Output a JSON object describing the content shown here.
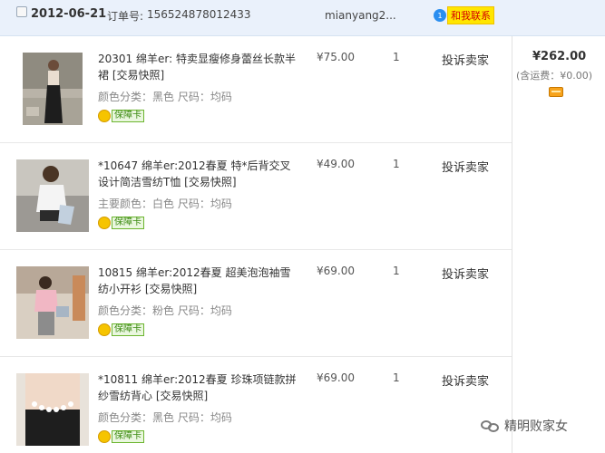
{
  "order": {
    "date": "2012-06-21",
    "order_no_label": "订单号:",
    "order_no": "156524878012433",
    "seller": "mianyang2...",
    "contact_count": "1",
    "contact_label": "和我联系"
  },
  "items": [
    {
      "title": "20301 绵羊er: 特卖显瘦修身蕾丝长款半裙 [交易快照]",
      "attr": "颜色分类：黑色  尺码：均码",
      "guarantee": "保障卡",
      "price": "¥75.00",
      "qty": "1",
      "complain": "投诉卖家"
    },
    {
      "title": "*10647 绵羊er:2012春夏 特*后背交叉设计简洁雪纺T恤 [交易快照]",
      "attr": "主要颜色：白色  尺码：均码",
      "guarantee": "保障卡",
      "price": "¥49.00",
      "qty": "1",
      "complain": "投诉卖家"
    },
    {
      "title": "10815 绵羊er:2012春夏 超美泡泡袖雪纺小开衫 [交易快照]",
      "attr": "颜色分类：粉色  尺码：均码",
      "guarantee": "保障卡",
      "price": "¥69.00",
      "qty": "1",
      "complain": "投诉卖家"
    },
    {
      "title": "*10811 绵羊er:2012春夏 珍珠项链款拼纱雪纺背心 [交易快照]",
      "attr": "颜色分类：黑色  尺码：均码",
      "guarantee": "保障卡",
      "price": "¥69.00",
      "qty": "1",
      "complain": "投诉卖家"
    }
  ],
  "total": {
    "amount": "¥262.00",
    "shipping": "(含运费：¥0.00)"
  },
  "watermark": "精明败家女"
}
